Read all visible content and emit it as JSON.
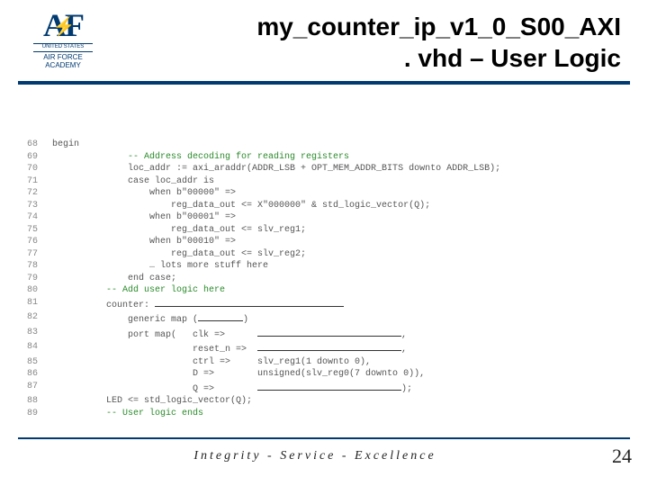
{
  "logo": {
    "mark": "AF",
    "line0": "UNITED STATES",
    "line1": "AIR FORCE",
    "line2": "ACADEMY"
  },
  "title": {
    "line1": "my_counter_ip_v1_0_S00_AXI",
    "line2": ". vhd – User Logic"
  },
  "code": [
    {
      "n": "68",
      "t": "begin",
      "cls": ""
    },
    {
      "n": "69",
      "t": "              -- Address decoding for reading registers",
      "cls": "cm"
    },
    {
      "n": "70",
      "t": "              loc_addr := axi_araddr(ADDR_LSB + OPT_MEM_ADDR_BITS downto ADDR_LSB);",
      "cls": ""
    },
    {
      "n": "71",
      "t": "              case loc_addr is",
      "cls": ""
    },
    {
      "n": "72",
      "t": "                  when b\"00000\" =>",
      "cls": ""
    },
    {
      "n": "73",
      "t": "                      reg_data_out <= X\"000000\" & std_logic_vector(Q);",
      "cls": ""
    },
    {
      "n": "74",
      "t": "                  when b\"00001\" =>",
      "cls": ""
    },
    {
      "n": "75",
      "t": "                      reg_data_out <= slv_reg1;",
      "cls": ""
    },
    {
      "n": "76",
      "t": "                  when b\"00010\" =>",
      "cls": ""
    },
    {
      "n": "77",
      "t": "                      reg_data_out <= slv_reg2;",
      "cls": ""
    },
    {
      "n": "78",
      "t": "                  … lots more stuff here",
      "cls": ""
    },
    {
      "n": "79",
      "t": "              end case;",
      "cls": ""
    },
    {
      "n": "80",
      "t": "          -- Add user logic here",
      "cls": "cm"
    },
    {
      "n": "81",
      "t": "",
      "cls": "b81"
    },
    {
      "n": "82",
      "t": "",
      "cls": "b82"
    },
    {
      "n": "83",
      "t": "",
      "cls": "b83"
    },
    {
      "n": "84",
      "t": "",
      "cls": "b84"
    },
    {
      "n": "85",
      "t": "",
      "cls": "b85"
    },
    {
      "n": "86",
      "t": "",
      "cls": "b86"
    },
    {
      "n": "87",
      "t": "",
      "cls": "b87"
    },
    {
      "n": "88",
      "t": "          LED <= std_logic_vector(Q);",
      "cls": ""
    },
    {
      "n": "89",
      "t": "          -- User logic ends",
      "cls": "cm"
    }
  ],
  "blanks": {
    "b81": {
      "pre": "          counter: ",
      "mid": "",
      "suf": "",
      "bl": [
        "bl-short",
        "bl-long"
      ]
    },
    "b82": {
      "pre": "              generic map (",
      "mid": ")",
      "bl": [
        "bl-short"
      ]
    },
    "b83": {
      "pre": "              port map(   clk =>      ",
      "suf": ",",
      "bl": [
        "bl-long"
      ]
    },
    "b84": {
      "pre": "                          reset_n =>  ",
      "suf": ",",
      "bl": [
        "bl-long"
      ]
    },
    "b85": {
      "pre": "                          ctrl =>     ",
      "suf2": "slv_reg1(1 downto 0),",
      "bl": []
    },
    "b86": {
      "pre": "                          D =>        ",
      "suf2": "unsigned(slv_reg0(7 downto 0)),",
      "bl": []
    },
    "b87": {
      "pre": "                          Q =>        ",
      "suf": ");",
      "bl": [
        "bl-long"
      ]
    }
  },
  "footer": {
    "motto": "Integrity - Service - Excellence",
    "page": "24"
  }
}
